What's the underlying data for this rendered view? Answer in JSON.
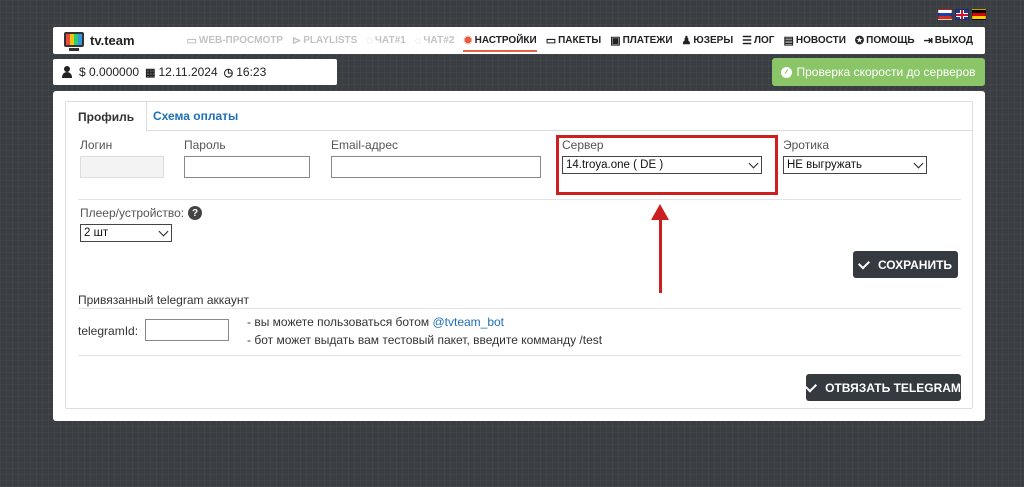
{
  "brand": {
    "name": "tv.team"
  },
  "languages": [
    "Русский",
    "English",
    "Deutsch"
  ],
  "nav": [
    {
      "label": "WEB-ПРОСМОТР",
      "icon": "monitor-icon",
      "state": "disabled"
    },
    {
      "label": "PLAYLISTS",
      "icon": "play-circle-icon",
      "state": "disabled"
    },
    {
      "label": "ЧАТ#1",
      "icon": "chat-icon",
      "state": "disabled"
    },
    {
      "label": "ЧАТ#2",
      "icon": "chat-icon",
      "state": "disabled"
    },
    {
      "label": "НАСТРОЙКИ",
      "icon": "gear-icon",
      "state": "active"
    },
    {
      "label": "ПАКЕТЫ",
      "icon": "tv-icon",
      "state": "normal"
    },
    {
      "label": "ПЛАТЕЖИ",
      "icon": "money-icon",
      "state": "normal"
    },
    {
      "label": "ЮЗЕРЫ",
      "icon": "users-icon",
      "state": "normal"
    },
    {
      "label": "ЛОГ",
      "icon": "list-icon",
      "state": "normal"
    },
    {
      "label": "НОВОСТИ",
      "icon": "news-icon",
      "state": "normal"
    },
    {
      "label": "ПОМОЩЬ",
      "icon": "help-icon",
      "state": "normal"
    },
    {
      "label": "ВЫХОД",
      "icon": "exit-icon",
      "state": "normal"
    }
  ],
  "userbar": {
    "balance": "$ 0.000000",
    "date": "12.11.2024",
    "time": "16:23"
  },
  "speed_test": {
    "label": "Проверка скорости до серверов"
  },
  "tabs": {
    "profile": "Профиль",
    "payment": "Схема оплаты"
  },
  "form": {
    "login": {
      "label": "Логин",
      "value": ""
    },
    "password": {
      "label": "Пароль",
      "value": ""
    },
    "email": {
      "label": "Email-адрес",
      "value": ""
    },
    "server": {
      "label": "Сервер",
      "value": "14.troya.one ( DE )"
    },
    "erotica": {
      "label": "Эротика",
      "value": "НЕ выгружать"
    },
    "player": {
      "label": "Плеер/устройство:",
      "value": "2 шт"
    },
    "save_label": "СОХРАНИТЬ"
  },
  "telegram": {
    "heading": "Привязанный telegram аккаунт",
    "id_label": "telegramId:",
    "id_value": "",
    "line1_prefix": "- вы можете пользоваться ботом ",
    "bot_link": "@tvteam_bot",
    "line2": "- бот может выдать вам тестовый пакет, введите комманду /test",
    "bind_label": "ОТВЯЗАТЬ TELEGRAM"
  },
  "accent_colors": {
    "highlight": "#cc1f1f",
    "active_tab": "#e3634a",
    "speed_button": "#8ac667",
    "link": "#1f6fb5"
  }
}
